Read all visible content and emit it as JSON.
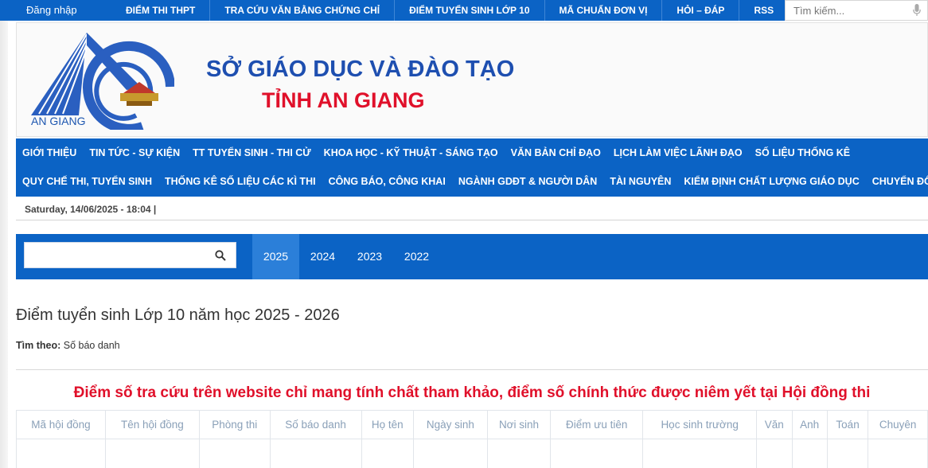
{
  "topbar": {
    "login_label": "Đăng nhập",
    "links": [
      "ĐIỂM THI THPT",
      "TRA CỨU VĂN BẰNG CHỨNG CHỈ",
      "ĐIỂM TUYỂN SINH LỚP 10",
      "MÃ CHUẨN ĐƠN VỊ",
      "HỎI – ĐÁP",
      "RSS"
    ],
    "search_placeholder": "Tìm kiếm..."
  },
  "banner": {
    "logo_label": "AN GIANG",
    "org_line1": "SỞ GIÁO DỤC VÀ ĐÀO TẠO",
    "org_line2": "TỈNH AN GIANG"
  },
  "nav": {
    "row1": [
      "GIỚI THIỆU",
      "TIN TỨC - SỰ KIỆN",
      "TT TUYỂN SINH - THI CỬ",
      "KHOA HỌC - KỸ THUẬT - SÁNG TẠO",
      "VĂN BẢN CHỈ ĐẠO",
      "LỊCH LÀM VIỆC LÃNH ĐẠO",
      "SỐ LIỆU THỐNG KÊ"
    ],
    "row2": [
      "QUY CHẾ THI, TUYỂN SINH",
      "THỐNG KÊ SỐ LIỆU CÁC KÌ THI",
      "CÔNG BÁO, CÔNG KHAI",
      "NGÀNH GDĐT & NGƯỜI DÂN",
      "TÀI NGUYÊN",
      "KIỂM ĐỊNH CHẤT LƯỢNG GIÁO DỤC",
      "CHUYỂN ĐỔI SỐ"
    ]
  },
  "datebar": {
    "text": "Saturday, 14/06/2025 - 18:04   |"
  },
  "years": {
    "items": [
      "2025",
      "2024",
      "2023",
      "2022"
    ],
    "active": "2025"
  },
  "main": {
    "title": "Điểm tuyển sinh Lớp 10 năm học 2025 - 2026",
    "find_by_label": "Tìm theo:",
    "find_by_value": "Số báo danh",
    "notice": "Điểm số tra cứu trên website chỉ mang tính chất tham khảo, điểm số chính thức được niêm yết tại Hội đồng thi"
  },
  "table": {
    "headers": [
      "Mã hội đồng",
      "Tên hội đồng",
      "Phòng thi",
      "Số báo danh",
      "Họ tên",
      "Ngày sinh",
      "Nơi sinh",
      "Điểm ưu tiên",
      "Học sinh trường",
      "Văn",
      "Anh",
      "Toán",
      "Chuyên"
    ]
  },
  "colors": {
    "primary": "#0b63c5",
    "active_tab": "#2b7fd9",
    "accent_red": "#e0102a",
    "title_blue": "#1e4fb0"
  }
}
